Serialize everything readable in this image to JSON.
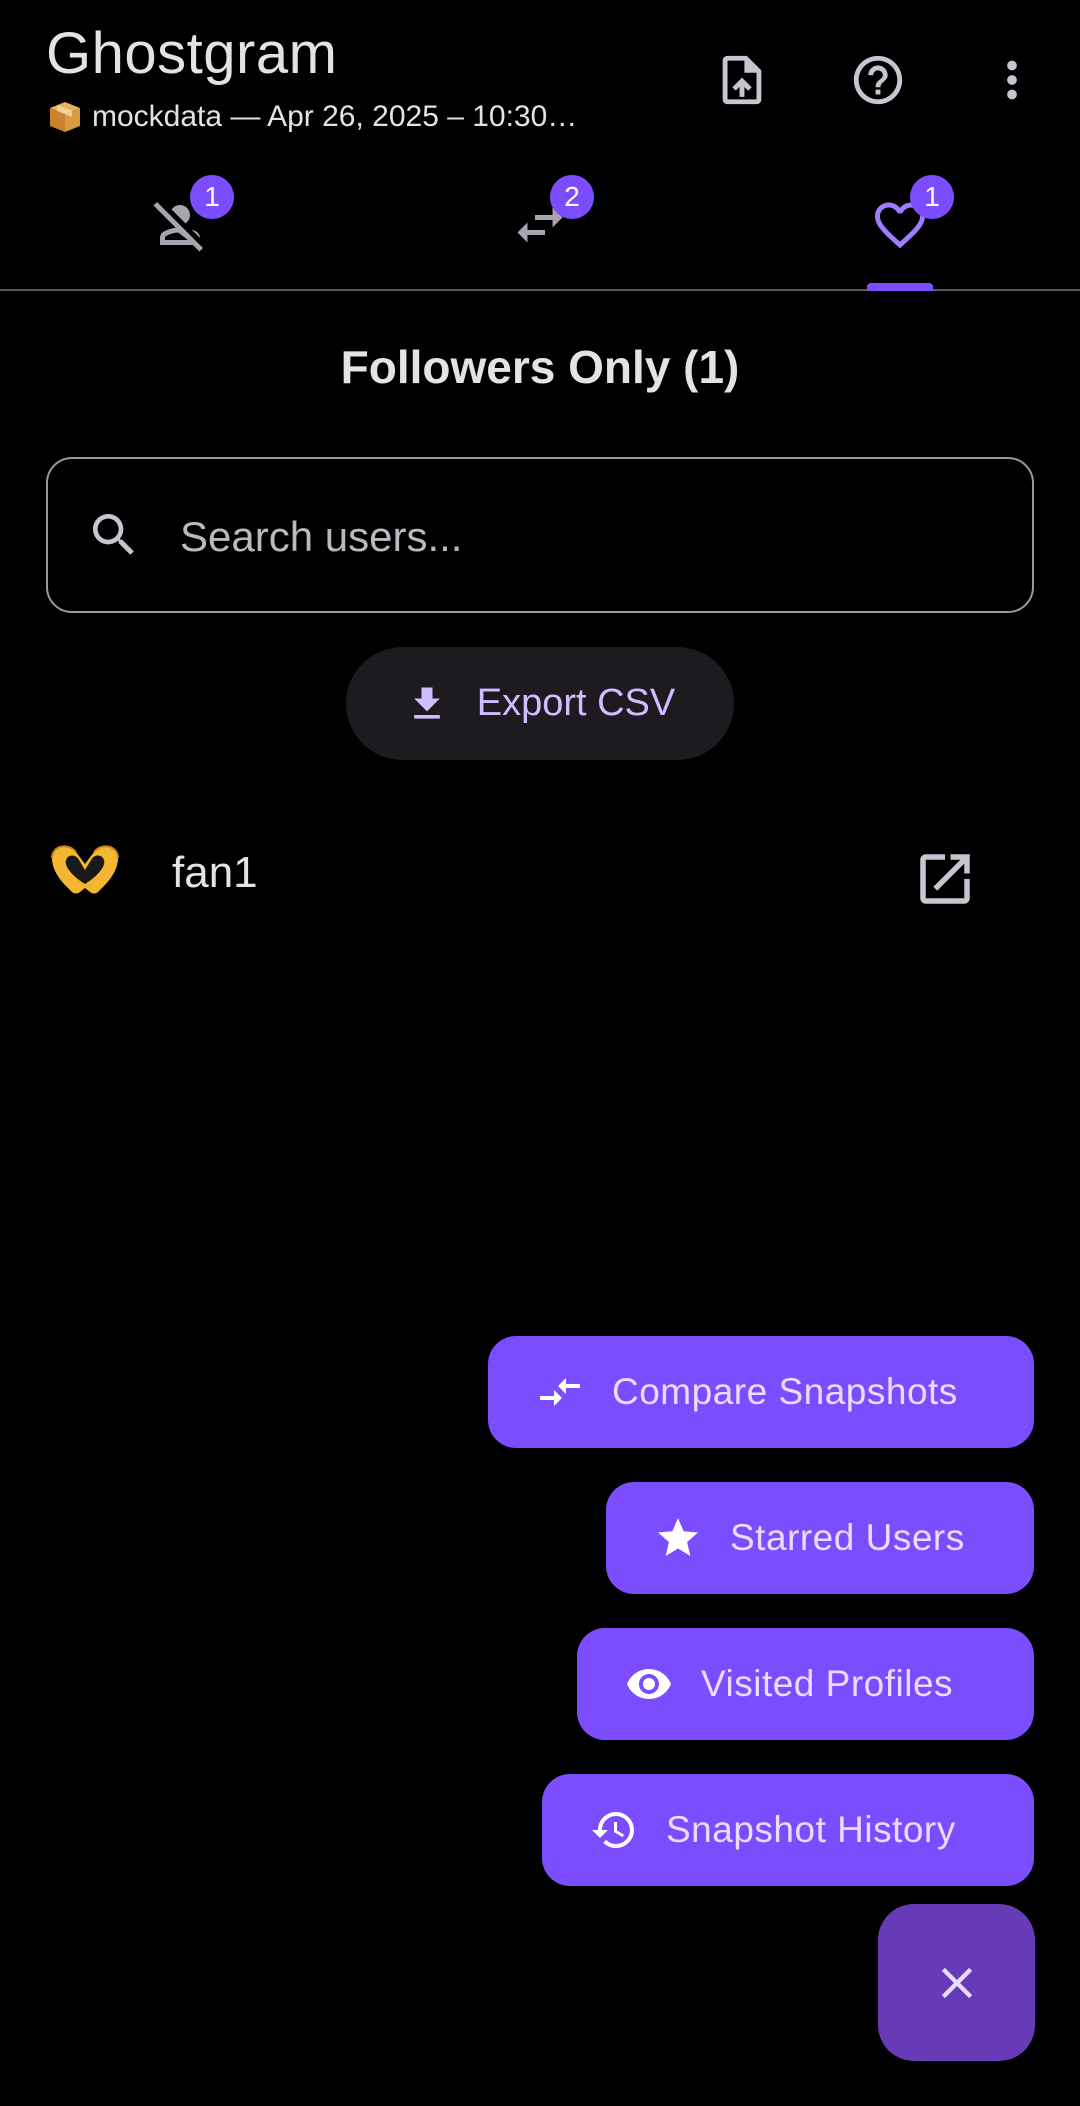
{
  "app": {
    "title": "Ghostgram",
    "subtitle": "mockdata — Apr 26, 2025 – 10:30…",
    "subtitle_icon": "package-icon"
  },
  "appbar_actions": [
    {
      "name": "import-file-icon"
    },
    {
      "name": "help-icon"
    },
    {
      "name": "more-vert-icon"
    }
  ],
  "tabs": [
    {
      "icon": "unfollow-person-off-icon",
      "badge": "1",
      "selected": false
    },
    {
      "icon": "swap-horiz-icon",
      "badge": "2",
      "selected": false
    },
    {
      "icon": "heart-icon",
      "badge": "1",
      "selected": true
    }
  ],
  "section": {
    "title": "Followers Only (1)"
  },
  "search": {
    "placeholder": "Search users...",
    "value": ""
  },
  "export": {
    "label": "Export CSV"
  },
  "users": [
    {
      "emoji": "heart-hands-icon",
      "name": "fan1"
    }
  ],
  "fab_menu": {
    "actions": [
      {
        "label": "Compare Snapshots",
        "icon": "compare-arrows-icon"
      },
      {
        "label": "Starred Users",
        "icon": "star-icon"
      },
      {
        "label": "Visited Profiles",
        "icon": "eye-icon"
      },
      {
        "label": "Snapshot History",
        "icon": "history-icon"
      }
    ],
    "close_icon": "close-icon"
  },
  "colors": {
    "accent": "#7c4dff",
    "fab_main": "#673ab7",
    "background": "#000000",
    "export_text": "#d0bcff"
  }
}
